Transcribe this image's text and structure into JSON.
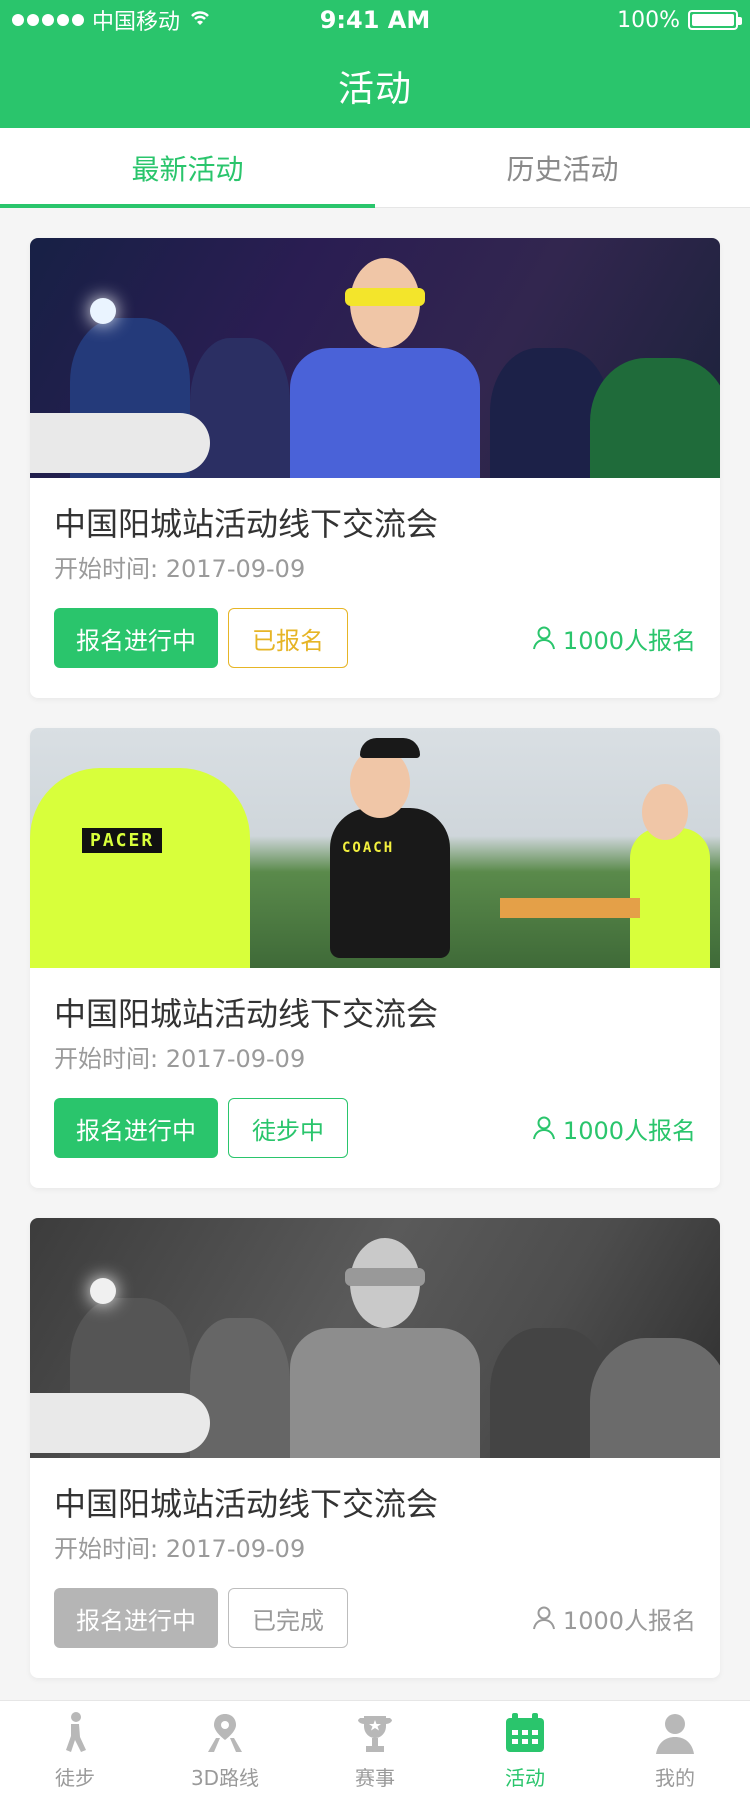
{
  "status_bar": {
    "carrier": "中国移动",
    "time": "9:41 AM",
    "battery": "100%",
    "signal_icon": "signal-dots-icon",
    "wifi_icon": "wifi-icon",
    "battery_level": 1.0
  },
  "header": {
    "title": "活动"
  },
  "tabs": [
    {
      "label": "最新活动",
      "active": true
    },
    {
      "label": "历史活动",
      "active": false
    }
  ],
  "activities": [
    {
      "title": "中国阳城站活动线下交流会",
      "date_label": "开始时间:",
      "date": "2017-09-09",
      "primary_button": "报名进行中",
      "primary_style": "green",
      "status_button": "已报名",
      "status_style": "yellow-outline",
      "signups": "1000人报名",
      "image": "night-run-event-photo"
    },
    {
      "title": "中国阳城站活动线下交流会",
      "date_label": "开始时间:",
      "date": "2017-09-09",
      "primary_button": "报名进行中",
      "primary_style": "green",
      "status_button": "徒步中",
      "status_style": "green-outline",
      "signups": "1000人报名",
      "image": "coach-pacer-photo"
    },
    {
      "title": "中国阳城站活动线下交流会",
      "date_label": "开始时间:",
      "date": "2017-09-09",
      "primary_button": "报名进行中",
      "primary_style": "gray",
      "status_button": "已完成",
      "status_style": "gray-outline",
      "signups": "1000人报名",
      "image": "night-run-event-photo-grayscale"
    }
  ],
  "tabbar": [
    {
      "label": "徒步",
      "icon": "walking-icon",
      "active": false
    },
    {
      "label": "3D路线",
      "icon": "route-pin-icon",
      "active": false
    },
    {
      "label": "赛事",
      "icon": "trophy-icon",
      "active": false
    },
    {
      "label": "活动",
      "icon": "calendar-icon",
      "active": true
    },
    {
      "label": "我的",
      "icon": "profile-icon",
      "active": false
    }
  ],
  "colors": {
    "accent": "#2ac56c",
    "yellow": "#e6b526",
    "gray": "#b5b5b5",
    "text_dark": "#333333",
    "text_muted": "#9a9a9a"
  }
}
